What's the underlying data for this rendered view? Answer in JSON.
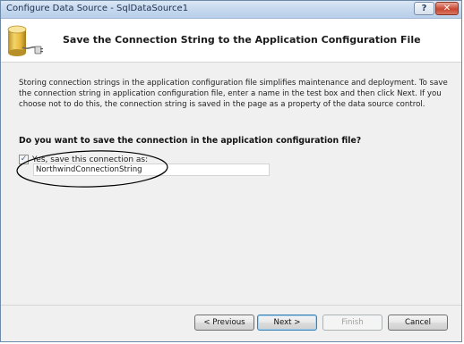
{
  "window": {
    "title": "Configure Data Source - SqlDataSource1",
    "help_label": "?",
    "close_label": "✕"
  },
  "header": {
    "title": "Save the Connection String to the Application Configuration File",
    "icon": "database-connection-icon"
  },
  "body": {
    "description": "Storing connection strings in the application configuration file simplifies maintenance and deployment. To save the connection string in application configuration file, enter a name in the test box and then click Next. If you choose not to do this, the connection string is saved in the page as a property of the data source control.",
    "question": "Do you want to save the connection in the application configuration file?",
    "save_checkbox": {
      "label": "Yes, save this connection as:",
      "checked": true,
      "check_glyph": "✓"
    },
    "connection_name": {
      "value": "NorthwindConnectionString"
    }
  },
  "buttons": {
    "previous": "< Previous",
    "next": "Next >",
    "finish": "Finish",
    "cancel": "Cancel"
  },
  "colors": {
    "title_bar": "#c5d8ee",
    "header_background": "#ffffff",
    "dialog_background": "#f0f0f0",
    "default_button_border": "#3c7fb1",
    "annotation_ellipse": "#000000"
  }
}
